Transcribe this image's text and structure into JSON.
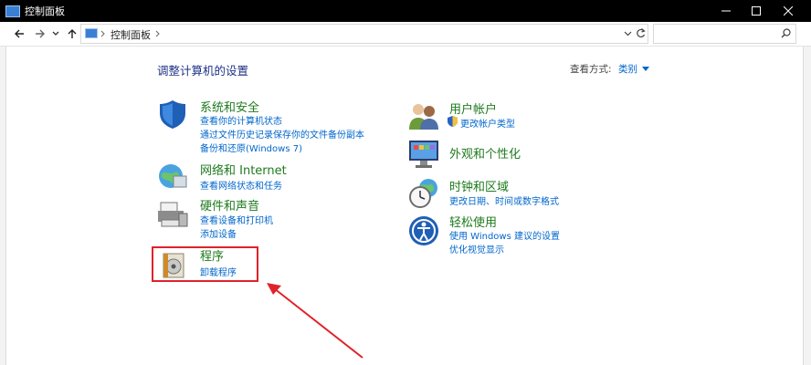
{
  "window": {
    "title": "控制面板"
  },
  "address": {
    "path": "控制面板"
  },
  "search": {
    "placeholder": ""
  },
  "page": {
    "heading": "调整计算机的设置",
    "view_label": "查看方式:",
    "view_value": "类别"
  },
  "categories_left": [
    {
      "title": "系统和安全",
      "links": [
        "查看你的计算机状态",
        "通过文件历史记录保存你的文件备份副本",
        "备份和还原(Windows 7)"
      ]
    },
    {
      "title": "网络和 Internet",
      "links": [
        "查看网络状态和任务"
      ]
    },
    {
      "title": "硬件和声音",
      "links": [
        "查看设备和打印机",
        "添加设备"
      ]
    },
    {
      "title": "程序",
      "links": [
        "卸载程序"
      ]
    }
  ],
  "categories_right": [
    {
      "title": "用户帐户",
      "links": [
        "更改帐户类型"
      ]
    },
    {
      "title": "外观和个性化",
      "links": []
    },
    {
      "title": "时钟和区域",
      "links": [
        "更改日期、时间或数字格式"
      ]
    },
    {
      "title": "轻松使用",
      "links": [
        "使用 Windows 建议的设置",
        "优化视觉显示"
      ]
    }
  ],
  "colors": {
    "accent": "#0066cc",
    "category_green": "#1e7a1e",
    "heading_blue": "#1e3287",
    "highlight_red": "#e0222a"
  }
}
